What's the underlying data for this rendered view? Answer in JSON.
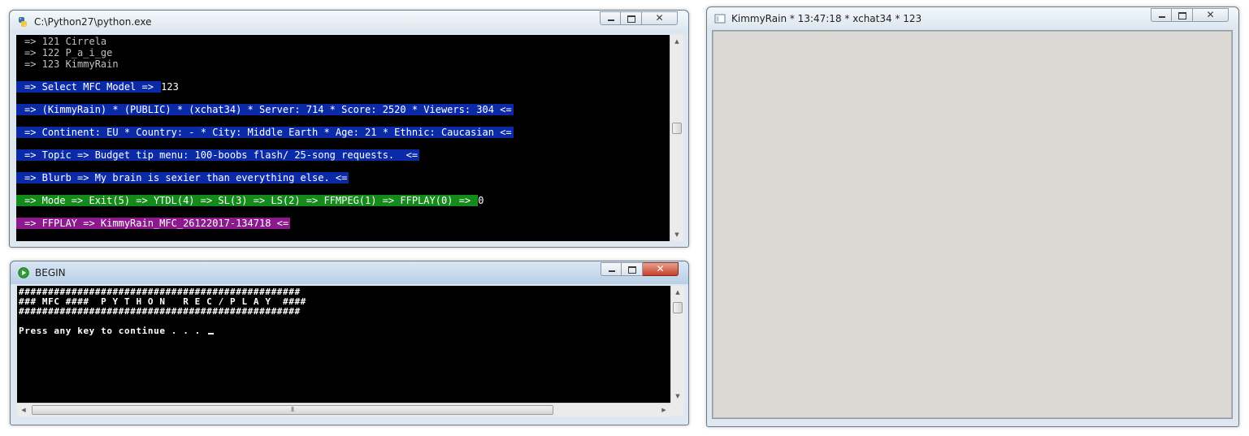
{
  "python_window": {
    "title": "C:\\Python27\\python.exe",
    "lines": [
      "=> 121 Cirrela",
      "=> 122 P_a_i_ge",
      "=> 123 KimmyRain"
    ],
    "select_prompt": "=> Select MFC Model => ",
    "select_value": "123",
    "info_line": "=> (KimmyRain) * (PUBLIC) * (xchat34) * Server: 714 * Score: 2520 * Viewers: 304 <=",
    "location_line": "=> Continent: EU * Country: - * City: Middle Earth * Age: 21 * Ethnic: Caucasian <=",
    "topic_line": "=> Topic => Budget tip menu: 100-boobs flash/ 25-song requests.  <=",
    "blurb_line": "=> Blurb => My brain is sexier than everything else. <=",
    "mode_prompt": "=> Mode => Exit(5) => YTDL(4) => SL(3) => LS(2) => FFMPEG(1) => FFPLAY(0) => ",
    "mode_value": "0",
    "ffplay_line": "=> FFPLAY => KimmyRain_MFC_26122017-134718 <=",
    "colors": {
      "blue_highlight": "#0a2aa8",
      "green_highlight": "#138a19",
      "magenta_highlight": "#8c1a8c"
    }
  },
  "begin_window": {
    "title": "BEGIN",
    "banner_border": "################################################",
    "banner_text": "### MFC ####  P Y T H O N   R E C / P L A Y  ####",
    "prompt": "Press any key to continue . . . "
  },
  "video_window": {
    "title": "KimmyRain * 13:47:18 * xchat34 * 123",
    "content": "video stream frame"
  },
  "icons": {
    "python": "python-icon",
    "begin": "green-play-icon",
    "video": "video-window-icon"
  }
}
